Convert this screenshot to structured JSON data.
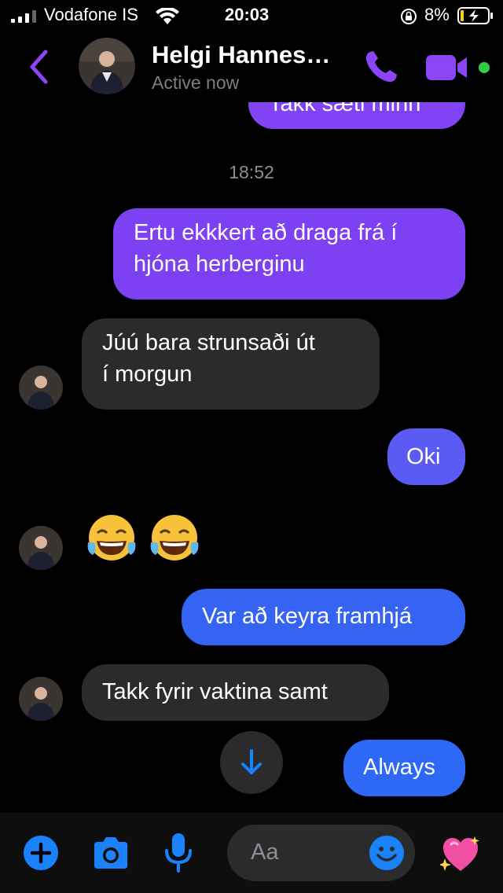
{
  "status_bar": {
    "carrier": "Vodafone IS",
    "time": "20:03",
    "battery_percent": "8%"
  },
  "header": {
    "contact_name": "Helgi Hannes…",
    "contact_status": "Active now",
    "accent_color": "#8b45f5",
    "active_color": "#31cc46"
  },
  "messages": {
    "partial_top": "Takk sæti minn",
    "timestamp": "18:52",
    "m1_line1": "Ertu ekkkert að draga frá í",
    "m1_line2": "hjóna herberginu",
    "m2_line1": "Júú bara strunsaði út",
    "m2_line2": "í morgun",
    "m3": "Oki",
    "m4_emoji": "face-with-tears-of-joy x2",
    "m5": "Var að keyra framhjá",
    "m6": "Takk fyrir vaktina samt",
    "m7": "Always"
  },
  "colors": {
    "outgoing_purple": "#7b41f2",
    "outgoing_indigo": "#5a5bf4",
    "outgoing_blue": "#2e68f6",
    "incoming_gray": "#2b2b2d",
    "composer_blue": "#1a82fb"
  },
  "composer": {
    "placeholder": "Aa"
  }
}
